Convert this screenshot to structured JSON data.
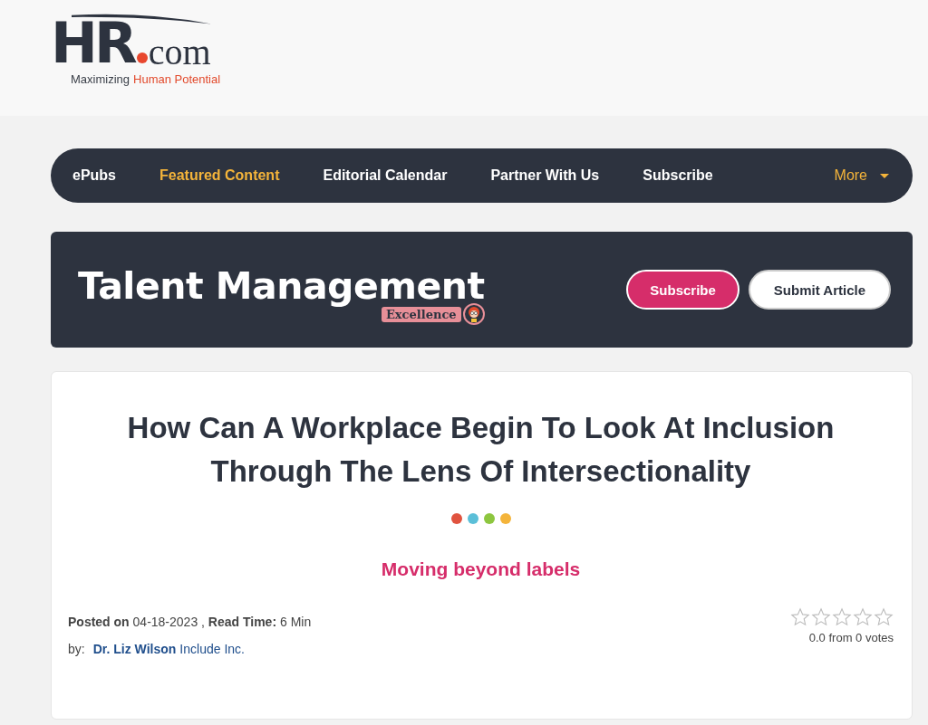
{
  "logo": {
    "mark": "HR",
    "suffix": "com",
    "tagline_start": "Maximizing",
    "tagline_end": "Human Potential"
  },
  "nav": {
    "items": [
      {
        "label": "ePubs",
        "selected": false
      },
      {
        "label": "Featured Content",
        "selected": true
      },
      {
        "label": "Editorial Calendar",
        "selected": false
      },
      {
        "label": "Partner With Us",
        "selected": false
      },
      {
        "label": "Subscribe",
        "selected": false
      }
    ],
    "more": {
      "label": "More",
      "selected": true
    }
  },
  "banner": {
    "title": "Talent Management",
    "badge": "Excellence",
    "buttons": [
      {
        "label": "Subscribe",
        "kind": "primary"
      },
      {
        "label": "Submit Article",
        "kind": "secondary"
      }
    ]
  },
  "article": {
    "title": "How Can A Workplace Begin To Look At Inclusion Through The Lens Of Intersectionality",
    "dots": [
      {
        "color": "#e0533f"
      },
      {
        "color": "#5bbfd8"
      },
      {
        "color": "#8dc63f"
      },
      {
        "color": "#f4b43a"
      }
    ],
    "subtitle": "Moving beyond labels",
    "meta": "**Posted on** 04-18-2023 , **Read Time:** 6 Min",
    "by_label": "by:",
    "author": "Dr. Liz Wilson",
    "company": "Include Inc.",
    "rating": {
      "stars": 0,
      "text": "0.0 from 0 votes"
    }
  }
}
